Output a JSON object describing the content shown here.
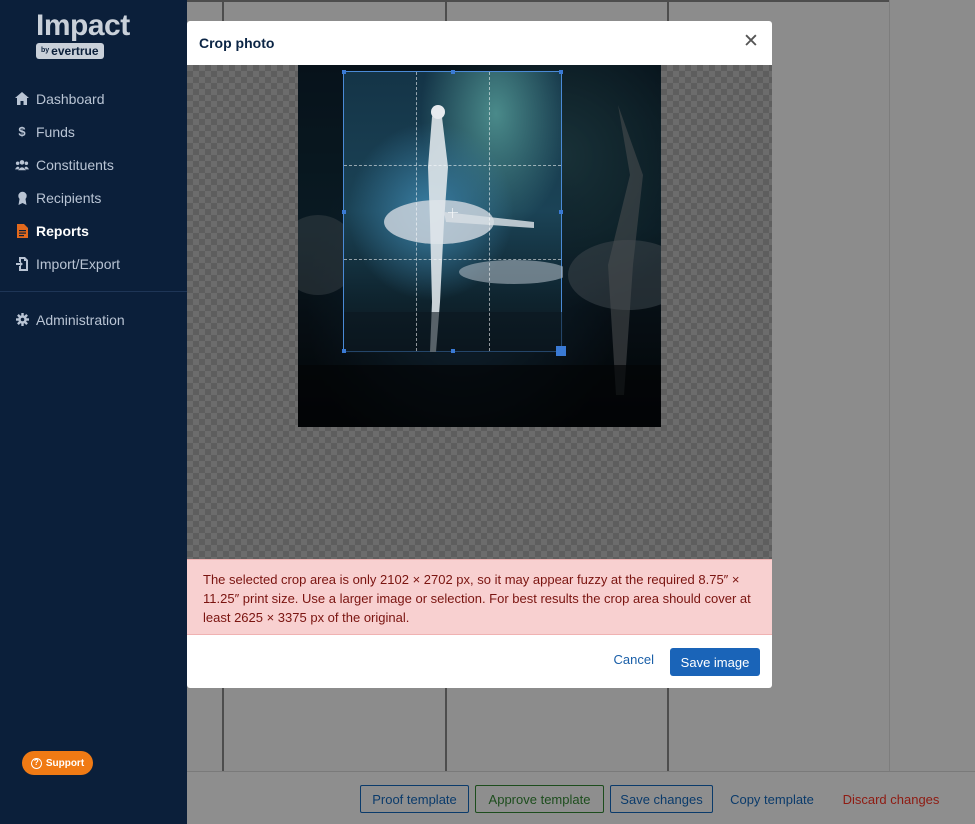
{
  "app": {
    "logo_main": "Impact",
    "logo_by": "by",
    "logo_brand": "evertrue"
  },
  "sidebar": {
    "items": [
      {
        "label": "Dashboard",
        "icon": "home-icon"
      },
      {
        "label": "Funds",
        "icon": "dollar-icon"
      },
      {
        "label": "Constituents",
        "icon": "users-icon"
      },
      {
        "label": "Recipients",
        "icon": "award-icon"
      },
      {
        "label": "Reports",
        "icon": "document-icon",
        "active": true
      },
      {
        "label": "Import/Export",
        "icon": "import-export-icon"
      }
    ],
    "admin": {
      "label": "Administration",
      "icon": "gear-icon"
    },
    "support_label": "Support"
  },
  "modal": {
    "title": "Crop photo",
    "warning": "The selected crop area is only 2102 × 2702 px, so it may appear fuzzy at the required 8.75″ × 11.25″ print size. Use a larger image or selection. For best results the crop area should cover at least 2625 × 3375 px of the original.",
    "cancel_label": "Cancel",
    "save_label": "Save image"
  },
  "toolbar": {
    "proof_label": "Proof template",
    "approve_label": "Approve template",
    "save_label": "Save changes",
    "copy_label": "Copy template",
    "discard_label": "Discard changes"
  },
  "colors": {
    "sidebar_bg": "#0b1f3a",
    "accent_blue": "#1a64b8",
    "warning_bg": "#f8d0d0",
    "support_orange": "#f07a14"
  }
}
